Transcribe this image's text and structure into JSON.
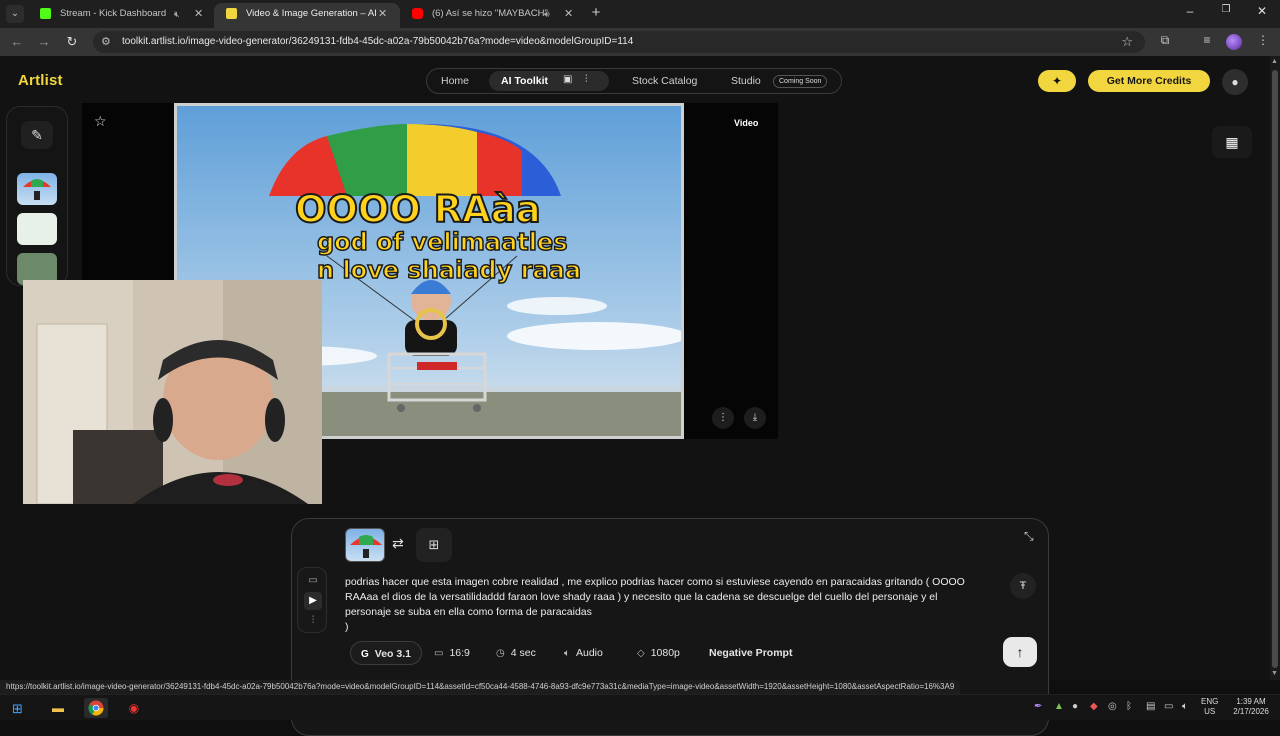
{
  "browser": {
    "tabs": [
      {
        "title": "Stream - Kick Dashboard",
        "favicon_color": "#53fc18",
        "active": false,
        "extra": "mute-icon"
      },
      {
        "title": "Video & Image Generation – AI",
        "favicon_color": "#f2d63f",
        "active": true
      },
      {
        "title": "(6) Así se hizo \"MAYBACH\"",
        "favicon_color": "#ff0000",
        "active": false,
        "extra": "speaker-icon"
      }
    ],
    "url": "toolkit.artlist.io/image-video-generator/36249131-fdb4-45dc-a02a-79b50042b76a?mode=video&modelGroupID=114",
    "status_url": "https://toolkit.artlist.io/image-video-generator/36249131-fdb4-45dc-a02a-79b50042b76a?mode=video&modelGroupID=114&assetId=cf50ca44-4588-4746-8a93-dfc9e773a31c&mediaType=image-video&assetWidth=1920&assetHeight=1080&assetAspectRatio=16%3A9"
  },
  "app": {
    "logo": "Artlist",
    "nav": {
      "home": "Home",
      "ai_toolkit": "AI Toolkit",
      "stock": "Stock Catalog",
      "studio": "Studio",
      "studio_badge": "Coming Soon"
    },
    "credits_button": "Get More Credits",
    "viewer": {
      "type_label": "Video"
    },
    "image_text": {
      "line1": "OOOO RAàa",
      "line2": "god of velimaatles",
      "line3": "n love shaiady raaa"
    }
  },
  "prompt": {
    "text": "podrias hacer que esta imagen cobre realidad , me explico podrias hacer como si estuviese cayendo en paracaidas gritando ( OOOO RAAaa el dios de la versatilidaddd faraon love shady raaa ) y necesito que la cadena se descuelge del cuello del personaje y el personaje se suba en ella como forma de paracaidas\n)",
    "options": {
      "model": "Veo 3.1",
      "ratio": "16:9",
      "duration": "4 sec",
      "audio": "Audio",
      "resolution": "1080p",
      "negative": "Negative Prompt"
    }
  },
  "taskbar": {
    "lang1": "ENG",
    "lang2": "US",
    "time": "1:39 AM",
    "date": "2/17/2026"
  },
  "colors": {
    "accent": "#f2d63f",
    "bg": "#121212"
  }
}
